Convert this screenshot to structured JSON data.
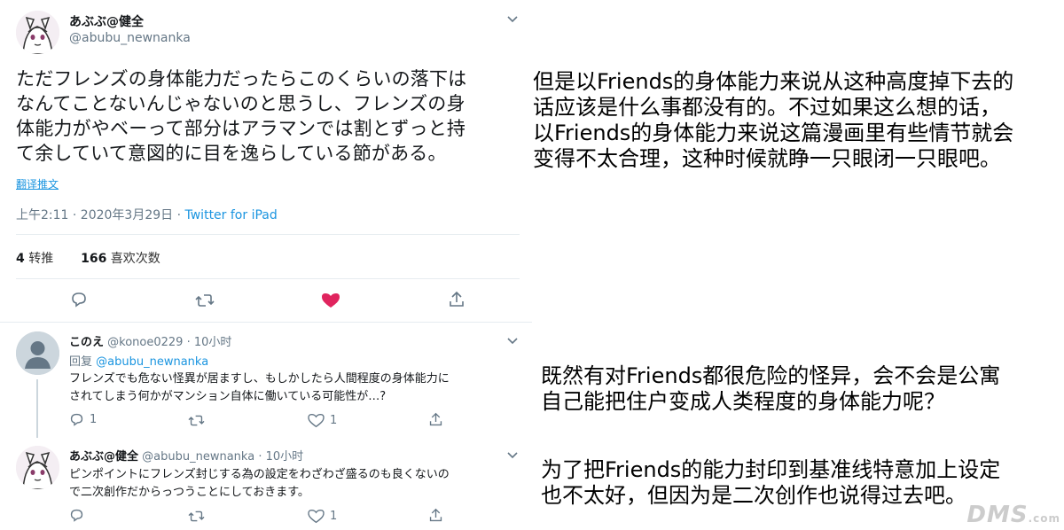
{
  "main_tweet": {
    "name": "あぶぶ@健全",
    "handle": "@abubu_newnanka",
    "text_lines": [
      "ただフレンズの身体能力だったらこのくらいの落下は",
      "なんてことないんじゃないのと思うし、フレンズの身",
      "体能力がやベーって部分はアラマンでは割とずっと持",
      "て余していて意図的に目を逸らしている節がある。"
    ],
    "translate_label": "翻译推文",
    "timestamp": "上午2:11 · 2020年3月29日 · ",
    "source": "Twitter for iPad",
    "retweet_count": "4",
    "retweet_label": "转推",
    "like_count": "166",
    "like_label": "喜欢次数",
    "heart_color": "#e0245e"
  },
  "replies": [
    {
      "name": "このえ",
      "handle_time": "@konoe0229 · 10小时",
      "reply_prefix": "回复",
      "reply_to": "@abubu_newnanka",
      "text_lines": [
        "フレンズでも危ない怪異が居ますし、もしかしたら人間程度の身体能力に",
        "されてしまう何かがマンション自体に働いている可能性が…?"
      ],
      "reply_count": "1",
      "retweet_count": "",
      "like_count": "1"
    },
    {
      "name": "あぶぶ@健全",
      "handle_time": "@abubu_newnanka · 10小时",
      "text_lines": [
        "ピンポイントにフレンズ封じする為の設定をわざわざ盛るのも良くないの",
        "で二次創作だからっつうことにしておきます。"
      ],
      "reply_count": "",
      "retweet_count": "",
      "like_count": "1"
    }
  ],
  "translations": {
    "block1": [
      "但是以Friends的身体能力来说从这种高度掉下去的",
      "话应该是什么事都没有的。不过如果这么想的话，",
      "以Friends的身体能力来说这篇漫画里有些情节就会",
      "变得不太合理，这种时候就睁一只眼闭一只眼吧。"
    ],
    "block2": [
      "既然有对Friends都很危险的怪异，会不会是公寓",
      "自己能把住户变成人类程度的身体能力呢？"
    ],
    "block3": [
      "为了把Friends的能力封印到基准线特意加上设定",
      "也不太好，但因为是二次创作也说得过去吧。"
    ]
  },
  "watermark": {
    "main": "DMS",
    "suffix": ".com"
  }
}
